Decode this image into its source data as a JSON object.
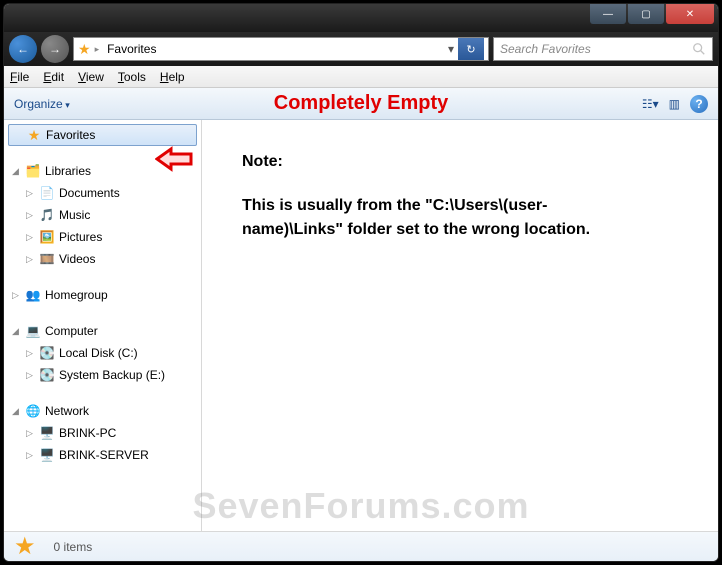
{
  "titlebar": {
    "minimize": "—",
    "maximize": "▢",
    "close": "✕"
  },
  "nav": {
    "back": "←",
    "forward": "→",
    "refresh": "↻"
  },
  "address": {
    "crumb": "Favorites",
    "dropdown": "▸"
  },
  "search": {
    "placeholder": "Search Favorites"
  },
  "menu": {
    "file": "File",
    "edit": "Edit",
    "view": "View",
    "tools": "Tools",
    "help": "Help"
  },
  "toolbar": {
    "organize": "Organize",
    "headline": "Completely Empty",
    "views_icon": "☷▾",
    "preview_icon": "▥",
    "help_icon": "?"
  },
  "tree": {
    "favorites": "Favorites",
    "libraries": "Libraries",
    "documents": "Documents",
    "music": "Music",
    "pictures": "Pictures",
    "videos": "Videos",
    "homegroup": "Homegroup",
    "computer": "Computer",
    "local_disk": "Local Disk (C:)",
    "system_backup": "System Backup (E:)",
    "network": "Network",
    "brink_pc": "BRINK-PC",
    "brink_server": "BRINK-SERVER"
  },
  "content": {
    "note_heading": "Note:",
    "note_body": "This is usually from the \"C:\\Users\\(user-name)\\Links\" folder set to the wrong location."
  },
  "status": {
    "items": "0 items"
  },
  "watermark": "SevenForums.com"
}
